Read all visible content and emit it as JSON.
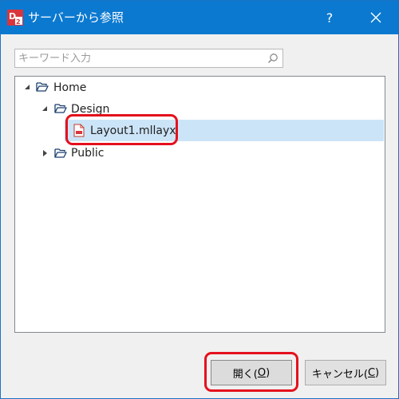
{
  "window": {
    "title": "サーバーから参照",
    "app_icon": "designer-app-icon",
    "help_label": "?",
    "close_icon": "close-icon"
  },
  "search": {
    "placeholder": "キーワード入力",
    "value": "",
    "icon": "search-icon"
  },
  "tree": {
    "home": {
      "label": "Home",
      "expanded": true
    },
    "design": {
      "label": "Design",
      "expanded": true
    },
    "file": {
      "label": "Layout1.mllayx",
      "selected": true,
      "icon": "layout-file-icon"
    },
    "public": {
      "label": "Public",
      "expanded": false
    }
  },
  "buttons": {
    "open_label": "開く(",
    "open_mnemonic": "O",
    "open_suffix": ")",
    "cancel_label": "キャンセル(",
    "cancel_mnemonic": "C",
    "cancel_suffix": ")"
  },
  "colors": {
    "titlebar": "#0b79d0",
    "selection": "#cce4f7",
    "highlight": "#e5101d"
  }
}
